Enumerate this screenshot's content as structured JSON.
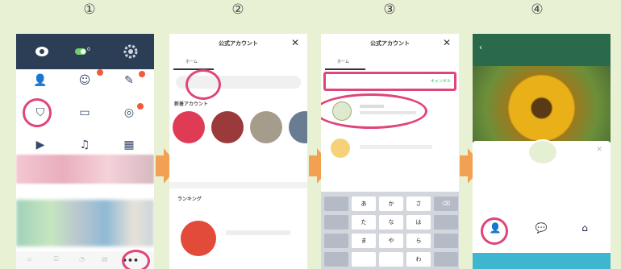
{
  "step_numbers": [
    "①",
    "②",
    "③",
    "④"
  ],
  "panel1": {
    "ribbon_icons": [
      "chat-icon",
      "toggle-icon",
      "gear-icon"
    ],
    "grid_labels": [
      "",
      "",
      "",
      "",
      "",
      "",
      "",
      "",
      "",
      "",
      "",
      ""
    ],
    "more_button": "•••"
  },
  "panel2": {
    "header_title": "公式アカウント",
    "close": "✕",
    "tabs": [
      "ホーム",
      "",
      ""
    ],
    "search_placeholder": "",
    "section_new": "新着アカウント",
    "section_ranking": "ランキング"
  },
  "panel3": {
    "header_title": "公式アカウント",
    "close": "✕",
    "search_value": "",
    "cancel_label": "キャンセル",
    "keyboard_rows": [
      [
        "",
        "あ",
        "か",
        "さ",
        "⌫"
      ],
      [
        "",
        "た",
        "な",
        "は",
        ""
      ],
      [
        "",
        "ま",
        "や",
        "ら",
        ""
      ],
      [
        "",
        "",
        "",
        "わ",
        ""
      ]
    ]
  },
  "panel4": {
    "topbar_title": "",
    "account_name": "",
    "nav": [
      {
        "icon": "person-icon",
        "label": ""
      },
      {
        "icon": "chat-bubble-icon",
        "label": ""
      },
      {
        "icon": "home-icon",
        "label": ""
      }
    ]
  }
}
